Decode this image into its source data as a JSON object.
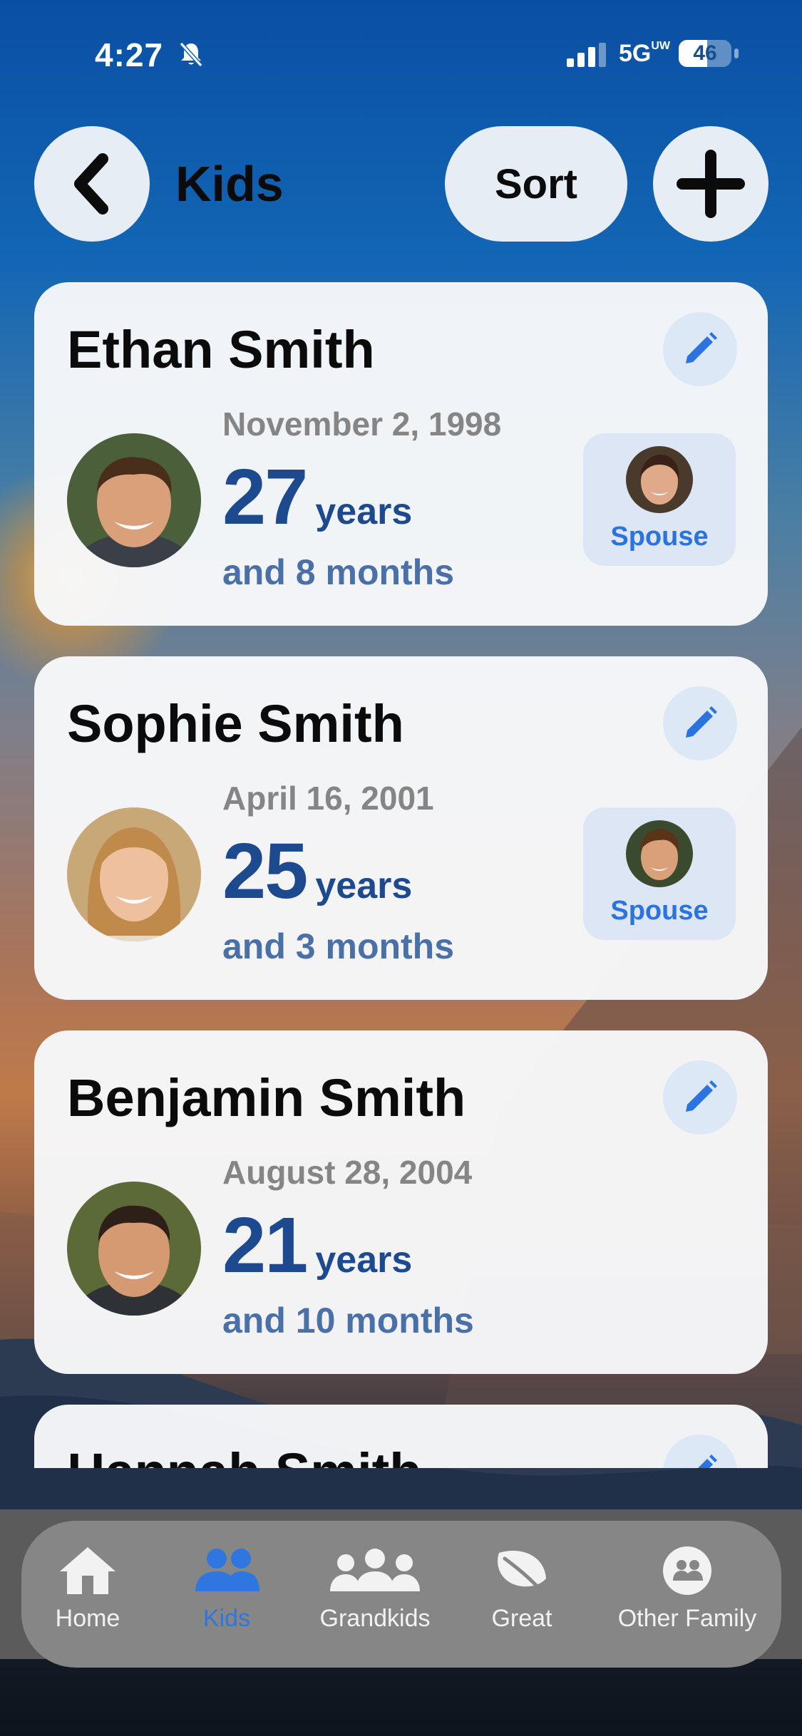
{
  "status_bar": {
    "time": "4:27",
    "network": "5G",
    "network_sup": "UW",
    "battery": "46"
  },
  "header": {
    "title": "Kids",
    "sort_label": "Sort"
  },
  "kids": [
    {
      "name": "Ethan Smith",
      "dob": "November 2, 1998",
      "age_years": "27",
      "years_label": "years",
      "months": "and 8 months",
      "spouse_label": "Spouse",
      "has_spouse": true
    },
    {
      "name": "Sophie Smith",
      "dob": "April 16, 2001",
      "age_years": "25",
      "years_label": "years",
      "months": "and 3 months",
      "spouse_label": "Spouse",
      "has_spouse": true
    },
    {
      "name": "Benjamin Smith",
      "dob": "August 28, 2004",
      "age_years": "21",
      "years_label": "years",
      "months": "and 10 months",
      "has_spouse": false
    },
    {
      "name": "Hannah Smith"
    }
  ],
  "tabs": [
    {
      "label": "Home",
      "icon": "home-icon",
      "active": false
    },
    {
      "label": "Kids",
      "icon": "people-icon",
      "active": true
    },
    {
      "label": "Grandkids",
      "icon": "group-icon",
      "active": false
    },
    {
      "label": "Great",
      "icon": "leaf-icon",
      "active": false
    },
    {
      "label": "Other Family",
      "icon": "family-icon",
      "active": false
    }
  ],
  "colors": {
    "accent": "#2f76e0",
    "age": "#1d4a8f",
    "months": "#4a70a8",
    "card": "#f7f8fa"
  }
}
